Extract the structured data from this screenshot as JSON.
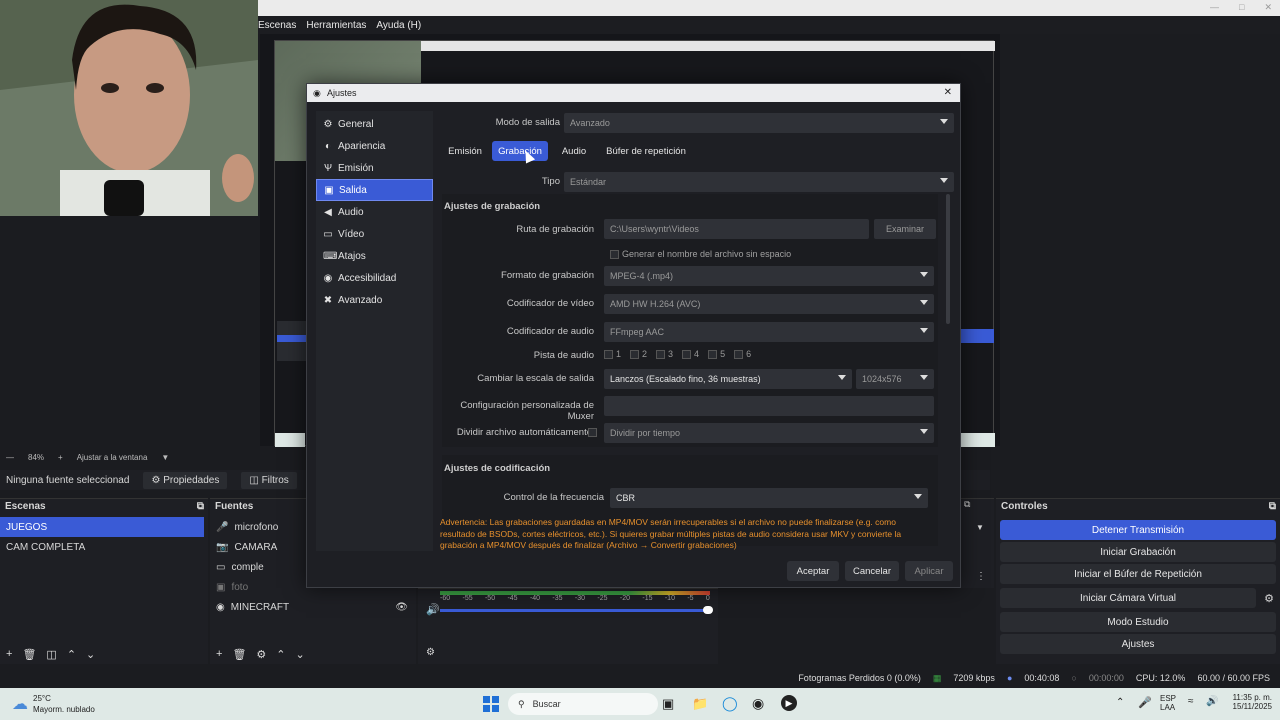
{
  "menu": {
    "items": [
      "Escenas",
      "Herramientas",
      "Ayuda (H)"
    ]
  },
  "zoom": {
    "level": "84%",
    "fit_label": "Ajustar a la ventana"
  },
  "sourcebar": {
    "selected": "Ninguna fuente seleccionad",
    "properties": "Propiedades",
    "filters": "Filtros"
  },
  "scenes": {
    "title": "Escenas",
    "items": [
      "JUEGOS",
      "CAM COMPLETA"
    ]
  },
  "sources": {
    "title": "Fuentes",
    "items": [
      "microfono",
      "CAMARA",
      "comple",
      "foto",
      "MINECRAFT"
    ]
  },
  "mixer": {
    "ticks": [
      "-60",
      "-55",
      "-50",
      "-45",
      "-40",
      "-35",
      "-30",
      "-25",
      "-20",
      "-15",
      "-10",
      "-5",
      "0"
    ]
  },
  "controls": {
    "title": "Controles",
    "buttons": [
      "Detener Transmisión",
      "Iniciar Grabación",
      "Iniciar el Búfer de Repetición",
      "Iniciar Cámara Virtual",
      "Modo Estudio",
      "Ajustes"
    ]
  },
  "status": {
    "dropped": "Fotogramas Perdidos 0 (0.0%)",
    "kbps": "7209 kbps",
    "stream_time": "00:40:08",
    "rec_time": "00:00:00",
    "cpu": "CPU: 12.0%",
    "fps": "60.00 / 60.00 FPS"
  },
  "taskbar": {
    "temp": "25°C",
    "weather": "Mayorm. nublado",
    "search": "Buscar",
    "lang1": "ESP",
    "lang2": "LAA",
    "time": "11:35 p. m.",
    "date": "15/11/2025"
  },
  "dialog": {
    "title": "Ajustes",
    "nav": [
      {
        "label": "General",
        "icon": "gear-icon"
      },
      {
        "label": "Apariencia",
        "icon": "palette-icon"
      },
      {
        "label": "Emisión",
        "icon": "antenna-icon"
      },
      {
        "label": "Salida",
        "icon": "output-icon"
      },
      {
        "label": "Audio",
        "icon": "speaker-icon"
      },
      {
        "label": "Vídeo",
        "icon": "monitor-icon"
      },
      {
        "label": "Atajos",
        "icon": "keyboard-icon"
      },
      {
        "label": "Accesibilidad",
        "icon": "accessibility-icon"
      },
      {
        "label": "Avanzado",
        "icon": "tools-icon"
      }
    ],
    "output_mode_label": "Modo de salida",
    "output_mode": "Avanzado",
    "tabs": [
      "Emisión",
      "Grabación",
      "Audio",
      "Búfer de repetición"
    ],
    "type_label": "Tipo",
    "type_value": "Estándar",
    "rec_section": "Ajustes de grabación",
    "path_label": "Ruta de grabación",
    "path_value": "C:\\Users\\wyntr\\Videos",
    "browse": "Examinar",
    "nospace_label": "Generar el nombre del archivo sin espacio",
    "format_label": "Formato de grabación",
    "format_value": "MPEG-4 (.mp4)",
    "vencoder_label": "Codificador de vídeo",
    "vencoder_value": "AMD HW H.264 (AVC)",
    "aencoder_label": "Codificador de audio",
    "aencoder_value": "FFmpeg AAC",
    "tracks_label": "Pista de audio",
    "tracks": [
      "1",
      "2",
      "3",
      "4",
      "5",
      "6"
    ],
    "rescale_label": "Cambiar la escala de salida",
    "rescale_value": "Lanczos (Escalado fino, 36 muestras)",
    "resolution": "1024x576",
    "muxer_label": "Configuración personalizada de Muxer",
    "split_label": "Dividir archivo automáticamente",
    "split_value": "Dividir por tiempo",
    "enc_section": "Ajustes de codificación",
    "rate_label": "Control de la frecuencia",
    "rate_value": "CBR",
    "warning": "Advertencia: Las grabaciones guardadas en MP4/MOV serán irrecuperables si el archivo no puede finalizarse (e.g. como resultado de BSODs, cortes eléctricos, etc.). Si quieres grabar múltiples pistas de audio considera usar MKV y convierte la grabación a MP4/MOV después de finalizar (Archivo → Convertir grabaciones)",
    "ok": "Aceptar",
    "cancel": "Cancelar",
    "apply": "Aplicar"
  }
}
